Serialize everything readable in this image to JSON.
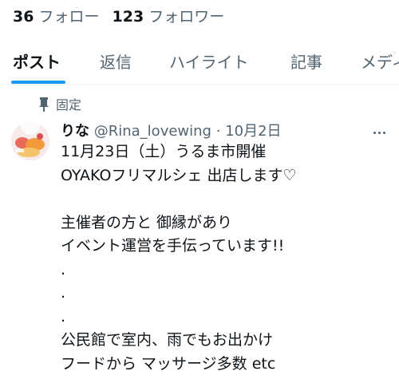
{
  "profile_stats": {
    "following_count": "36",
    "following_label": "フォロー",
    "followers_count": "123",
    "followers_label": "フォロワー"
  },
  "tabs": [
    {
      "label": "ポスト",
      "active": true
    },
    {
      "label": "返信",
      "active": false
    },
    {
      "label": "ハイライト",
      "active": false
    },
    {
      "label": "記事",
      "active": false
    },
    {
      "label": "メディ",
      "active": false
    }
  ],
  "pinned": {
    "label": "固定",
    "icon": "pin-icon"
  },
  "post": {
    "display_name": "りな",
    "handle": "@Rina_lovewing",
    "separator": "·",
    "date": "10月2日",
    "lines": [
      "11月23日（土）うるま市開催",
      "OYAKOフリマルシェ 出店します♡",
      "",
      "主催者の方と 御縁があり",
      "イベント運営を手伝っています!!",
      ".",
      ".",
      ".",
      "公民館で室内、雨でもお出かけ",
      "フードから マッサージ多数 etc"
    ]
  },
  "colors": {
    "accent": "#1d9bf0",
    "text_primary": "#0f1419",
    "text_secondary": "#536471",
    "divider": "#eff3f4"
  }
}
